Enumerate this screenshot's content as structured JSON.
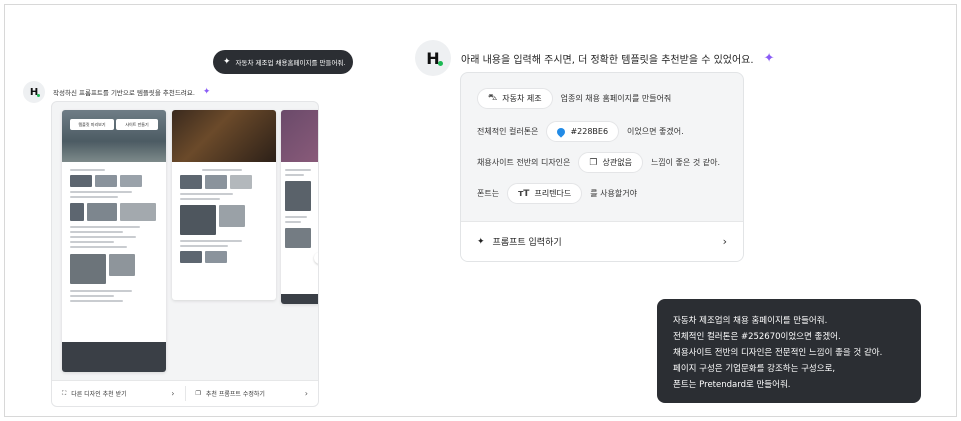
{
  "left": {
    "user_message": "자동차 제조업 채용홈페이지를 만들어줘.",
    "bot_message": "작성하신 프롬프트를 기반으로 템플릿을 추천드려요.",
    "logo_text": "H",
    "preview": {
      "pill_left": "템플릿 미리보기",
      "pill_right": "사이트 만들기",
      "other_design_label": "다른 디자인 추천 받기",
      "edit_prompt_label": "추천 프롬프트 수정하기",
      "chevron": "›"
    }
  },
  "right": {
    "logo_text": "H",
    "bot_message": "아래 내용을 입력해 주시면, 더 정확한 템플릿을 추천받을 수 있었어요.",
    "form": {
      "row1": {
        "chip": "자동차 제조",
        "suffix": "업종의 채용 홈페이지를 만들어줘"
      },
      "row2": {
        "prefix": "전체적인 컬러톤은",
        "chip": "#228BE6",
        "suffix": "이었으면 좋겠어."
      },
      "row3": {
        "prefix": "채용사이트 전반의 디자인은",
        "chip": "상관없음",
        "suffix": "느낌이 좋은 것 같아."
      },
      "row4": {
        "prefix": "폰트는",
        "chip": "프리텐다드",
        "suffix": "를 사용할거야"
      },
      "footer_label": "프롬프트 입력하기",
      "chevron": "›"
    },
    "response_lines": [
      "자동차 제조업의 채용 홈페이지를 만들어줘.",
      "전체적인 컬러톤은 #252670이었으면 좋겠어.",
      "채용사이트 전반의 디자인은 전문적인 느낌이 좋을 것 같아.",
      "페이지 구성은 기업문화를 강조하는 구성으로,",
      "폰트는 Pretendard로 만들어줘."
    ]
  },
  "colors": {
    "accent_blue": "#228be6",
    "spark_purple": "#8a5cf6",
    "dark_bubble": "#2b2e33",
    "logo_dot": "#1db954"
  },
  "icons": [
    "sparkle-icon",
    "car-icon",
    "color-drop-icon",
    "layout-icon",
    "font-icon",
    "sitemap-icon",
    "copy-icon",
    "chevron-right-icon"
  ]
}
